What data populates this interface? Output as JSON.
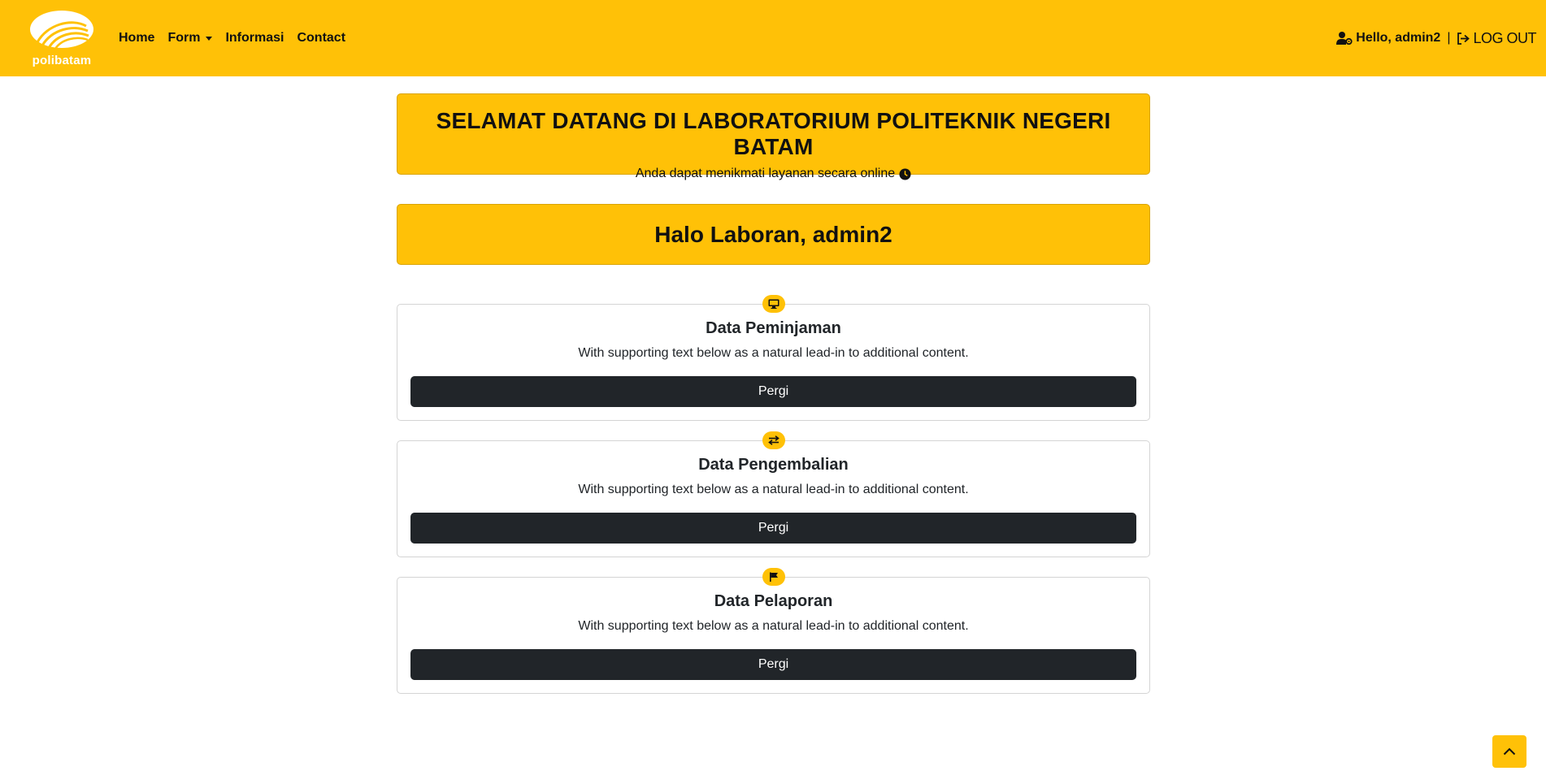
{
  "brand": {
    "logo_text": "polibatam"
  },
  "nav": {
    "home": "Home",
    "form": "Form",
    "informasi": "Informasi",
    "contact": "Contact"
  },
  "user": {
    "hello": "Hello, admin2",
    "separator": "|",
    "logout": "LOG OUT"
  },
  "welcome": {
    "title": "SELAMAT DATANG DI LABORATORIUM POLITEKNIK NEGERI BATAM",
    "subtitle": "Anda dapat menikmati layanan secara online"
  },
  "greeting": "Halo Laboran, admin2",
  "cards": [
    {
      "icon": "monitor-icon",
      "title": "Data Peminjaman",
      "text": "With supporting text below as a natural lead-in to additional content.",
      "button": "Pergi"
    },
    {
      "icon": "exchange-arrows-icon",
      "title": "Data Pengembalian",
      "text": "With supporting text below as a natural lead-in to additional content.",
      "button": "Pergi"
    },
    {
      "icon": "flag-icon",
      "title": "Data Pelaporan",
      "text": "With supporting text below as a natural lead-in to additional content.",
      "button": "Pergi"
    }
  ],
  "colors": {
    "primary": "#ffc107",
    "dark": "#212529"
  }
}
